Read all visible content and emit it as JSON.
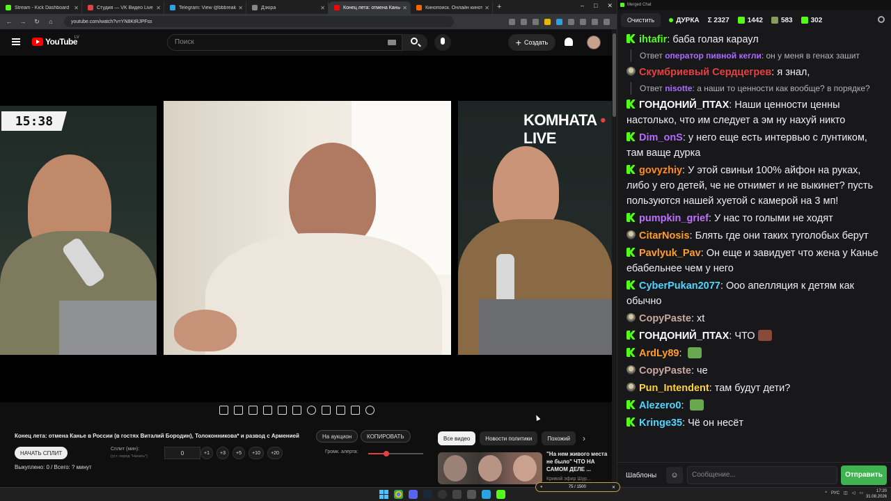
{
  "browser": {
    "tabs": [
      {
        "label": "Stream - Kick Dashboard",
        "color": "#53fc18"
      },
      {
        "label": "Студия — VK Видео Live",
        "color": "#e64141"
      },
      {
        "label": "Telegram: View @bbbreaking",
        "color": "#2aa3e0"
      },
      {
        "label": "Дзюра",
        "color": "#888888"
      },
      {
        "label": "Конец лета: отмена Канье",
        "color": "#ff0000"
      },
      {
        "label": "Кинопоиск. Онлайн кинотеатр",
        "color": "#ff6600"
      }
    ],
    "url": "youtube.com/watch?v=YN8KtRJPFss"
  },
  "youtube": {
    "logo_text": "YouTube",
    "country": "LV",
    "search_placeholder": "Поиск",
    "create_label": "Создать"
  },
  "video": {
    "timer": "15:38",
    "watermark_left": "KOMHATA",
    "watermark_dot": "•",
    "watermark_right": "LIVE"
  },
  "panel": {
    "title": "Конец лета: отмена Канье в России (в гостях Виталий Бородин), Толоконникова* и развод с Арменией",
    "auction_label": "На аукцион",
    "copy_label": "КОПИРОВАТЬ",
    "start_split_label": "НАЧАТЬ СПЛИТ",
    "split_label": "Сплит (мин):",
    "split_sub": "(уст. перед \"Начать\")",
    "split_value": "0",
    "increments": [
      "+1",
      "+3",
      "+5",
      "+10",
      "+20"
    ],
    "alert_label": "Громк. алерта:",
    "alert_volume": 0.33,
    "sold_text": "Выкуплено: 0 / Всего: ? минут"
  },
  "recommend": {
    "chips": [
      "Все видео",
      "Новости политики",
      "Похожий"
    ],
    "title": "\"На нем живого места не было\" ЧТО НА САМОМ ДЕЛЕ ...",
    "channel": "Кривой эфир Шур..."
  },
  "chat": {
    "window_title": "Merged Chat",
    "clear_label": "Очистить",
    "stream_name": "ДУРКА",
    "stats": [
      {
        "value": "Σ 2327",
        "color": "#ffffff"
      },
      {
        "value": "1442",
        "color": "#53fc18"
      },
      {
        "value": "583",
        "color": "#8a9a5b"
      },
      {
        "value": "302",
        "color": "#53fc18"
      }
    ],
    "messages": [
      {
        "badge": "kick",
        "nick": "ihtafir",
        "color": "#53fc18",
        "text": "баба голая караул"
      },
      {
        "reply": true,
        "prefix": "Ответ ",
        "rnick": "оператор пивной кегли",
        "rcolor": "#ab6cff",
        "text": ": он у меня в генах зашит"
      },
      {
        "badge": "face",
        "nick": "Скумбриевый Сердцегрев",
        "color": "#e64141",
        "text": "я знал,"
      },
      {
        "reply": true,
        "prefix": "Ответ ",
        "rnick": "nisotte",
        "rcolor": "#ab6cff",
        "text": ": а наши то ценности как вообще? в порядке?"
      },
      {
        "badge": "kick",
        "nick": "ГОНДОНИЙ_ПТАХ",
        "color": "#ffffff",
        "text": "Наши ценности ценны настолько, что им следует а эм ну нахуй никто"
      },
      {
        "badge": "kick",
        "nick": "Dim_onS",
        "color": "#b16cff",
        "text": "у него еще есть интервью с лунтиком, там ваще дурка"
      },
      {
        "badge": "kick",
        "nick": "govyzhiy",
        "color": "#ff8c1a",
        "text": "У этой свиньи 100% айфон на руках, либо у его детей, че не отнимет и не выкинет? пусть пользуются нашей хуетой с камерой на 3 мп!"
      },
      {
        "badge": "kick",
        "nick": "pumpkin_grief",
        "color": "#c070ff",
        "text": "У нас то голыми не ходят"
      },
      {
        "badge": "face",
        "nick": "CitarNosis",
        "color": "#ff9e2c",
        "text": "Блять где они таких туголобых берут"
      },
      {
        "badge": "kick",
        "nick": "Pavlyuk_Pav",
        "color": "#ff9e2c",
        "text": "Он еще и завидует что жена у Канье ебабельнее чем у него"
      },
      {
        "badge": "kick",
        "nick": "CyberPukan2077",
        "color": "#4fd6ff",
        "text": "Ооо апелляция к детям как обычно"
      },
      {
        "badge": "face",
        "nick": "CopyPaste",
        "color": "#c8a8a0",
        "text": "xt"
      },
      {
        "badge": "kick",
        "nick": "ГОНДОНИЙ_ПТАХ",
        "color": "#ffffff",
        "text": "ЧТО",
        "emote": "#8a4a3a"
      },
      {
        "badge": "kick",
        "nick": "ArdLy89",
        "color": "#ff9e2c",
        "text": "",
        "emote": "#6aa84f"
      },
      {
        "badge": "face",
        "nick": "CopyPaste",
        "color": "#c8a8a0",
        "text": "че"
      },
      {
        "badge": "face",
        "nick": "Pun_Intendent",
        "color": "#ffd23f",
        "text": "там будут дети?"
      },
      {
        "badge": "kick",
        "nick": "Alezero0",
        "color": "#4fd6ff",
        "text": "",
        "emote": "#6aa84f"
      },
      {
        "badge": "kick",
        "nick": "Kringe35",
        "color": "#4fd6ff",
        "text": "Чё он несёт"
      }
    ],
    "templates_label": "Шаблоны",
    "input_placeholder": "Сообщение...",
    "send_label": "Отправить"
  },
  "taskbar": {
    "overlay_text": "75 / 1500",
    "lang": "РУС",
    "time": "17:20",
    "date": "31.08.2026"
  }
}
